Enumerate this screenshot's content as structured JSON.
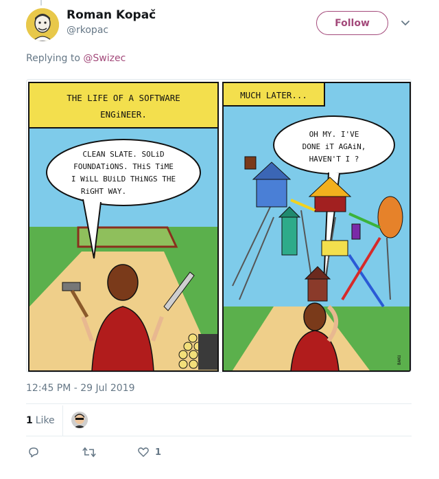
{
  "tweet": {
    "author_name": "Roman Kopač",
    "author_handle": "@rkopac",
    "follow_label": "Follow",
    "replying_prefix": "Replying to",
    "replying_to": "@Swizec",
    "timestamp": "12:45 PM - 29 Jul 2019",
    "likes_count": "1",
    "likes_label": "Like",
    "actions": {
      "reply_icon": "reply-icon",
      "retweet_icon": "retweet-icon",
      "like_icon": "heart-icon",
      "like_count": "1"
    }
  },
  "comic": {
    "panel1_caption_line1": "THE LIFE OF A SOFTWARE",
    "panel1_caption_line2": "ENGiNEER.",
    "panel1_bubble_line1": "CLEAN SLATE. SOLiD",
    "panel1_bubble_line2": "FOUNDATiONS. THiS TiME",
    "panel1_bubble_line3": "I WiLL BUiLD THiNGS THE",
    "panel1_bubble_line4": "RiGHT WAY.",
    "panel2_caption": "MUCH LATER...",
    "panel2_bubble_line1": "OH MY. I'VE",
    "panel2_bubble_line2": "DONE iT AGAiN,",
    "panel2_bubble_line3": "HAVEN'T I ?",
    "signature": "BAKU"
  },
  "colors": {
    "accent": "#a3497a",
    "secondary_text": "#657786",
    "caption_yellow": "#f3df4d",
    "sky": "#7ecbea",
    "grass": "#5bb04c",
    "path": "#efcf8a"
  }
}
